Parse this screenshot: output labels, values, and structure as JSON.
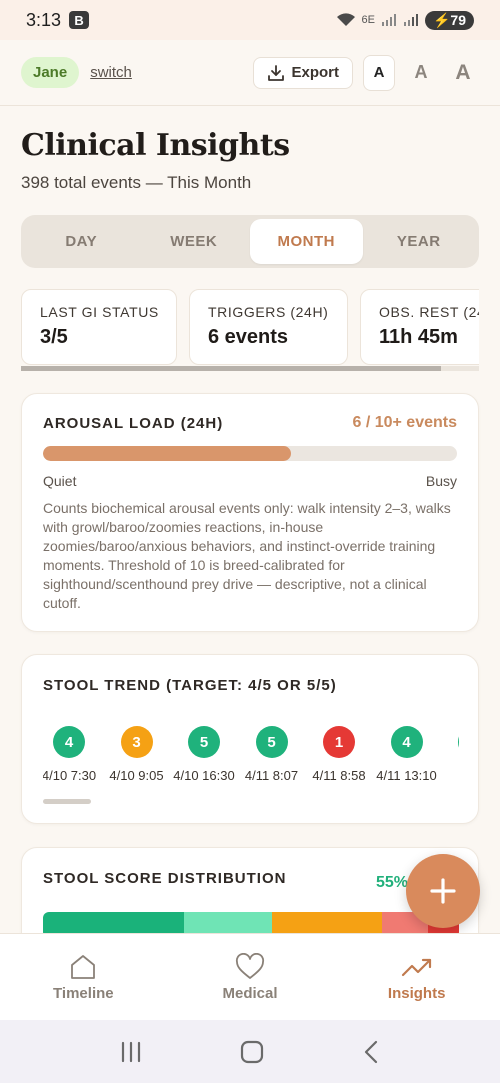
{
  "status": {
    "time": "3:13",
    "badge": "B",
    "network": "6E",
    "battery": "79"
  },
  "header": {
    "user": "Jane",
    "switch_label": "switch",
    "export_label": "Export",
    "font_sizes": [
      "A",
      "A",
      "A"
    ]
  },
  "page": {
    "title": "Clinical Insights",
    "subtitle": "398 total events — This Month"
  },
  "tabs": [
    {
      "label": "DAY",
      "active": false
    },
    {
      "label": "WEEK",
      "active": false
    },
    {
      "label": "MONTH",
      "active": true
    },
    {
      "label": "YEAR",
      "active": false
    }
  ],
  "stats": [
    {
      "label": "LAST GI STATUS",
      "value": "3/5"
    },
    {
      "label": "TRIGGERS (24H)",
      "value": "6 events"
    },
    {
      "label": "OBS. REST (24",
      "value": "11h 45m"
    }
  ],
  "arousal": {
    "title": "AROUSAL LOAD (24H)",
    "count": "6 / 10+ events",
    "level": 0.6,
    "low_label": "Quiet",
    "high_label": "Busy",
    "description": "Counts biochemical arousal events only: walk intensity 2–3, walks with growl/baroo/zoomies reactions, in-house zoomies/baroo/anxious behaviors, and instinct-override training moments. Threshold of 10 is breed-calibrated for sighthound/scenthound prey drive — descriptive, not a clinical cutoff."
  },
  "stool_trend": {
    "title": "STOOL TREND (TARGET: 4/5 OR 5/5)",
    "entries": [
      {
        "score": "4",
        "time": "4/10 7:30",
        "color": "#1fb27c"
      },
      {
        "score": "3",
        "time": "4/10 9:05",
        "color": "#f5a114"
      },
      {
        "score": "5",
        "time": "4/10 16:30",
        "color": "#1fb27c"
      },
      {
        "score": "5",
        "time": "4/11 8:07",
        "color": "#1fb27c"
      },
      {
        "score": "1",
        "time": "4/11 8:58",
        "color": "#e53935"
      },
      {
        "score": "4",
        "time": "4/11 13:10",
        "color": "#1fb27c"
      },
      {
        "score": "",
        "time": "4/",
        "color": "#1fb27c"
      }
    ]
  },
  "distribution": {
    "title": "STOOL SCORE DISTRIBUTION",
    "percent": "55%",
    "segments": [
      {
        "fraction": 0.34,
        "color": "#1ab27a"
      },
      {
        "fraction": 0.21,
        "color": "#6fe4b5"
      },
      {
        "fraction": 0.265,
        "color": "#f5a114"
      },
      {
        "fraction": 0.11,
        "color": "#f07a72"
      },
      {
        "fraction": 0.075,
        "color": "#e53935"
      }
    ]
  },
  "nav": [
    {
      "label": "Timeline",
      "icon": "home-icon",
      "active": false
    },
    {
      "label": "Medical",
      "icon": "heart-icon",
      "active": false
    },
    {
      "label": "Insights",
      "icon": "trend-icon",
      "active": true
    }
  ],
  "colors": {
    "accent": "#c07a4e",
    "fab": "#d98a5c",
    "good": "#1fb27c"
  }
}
